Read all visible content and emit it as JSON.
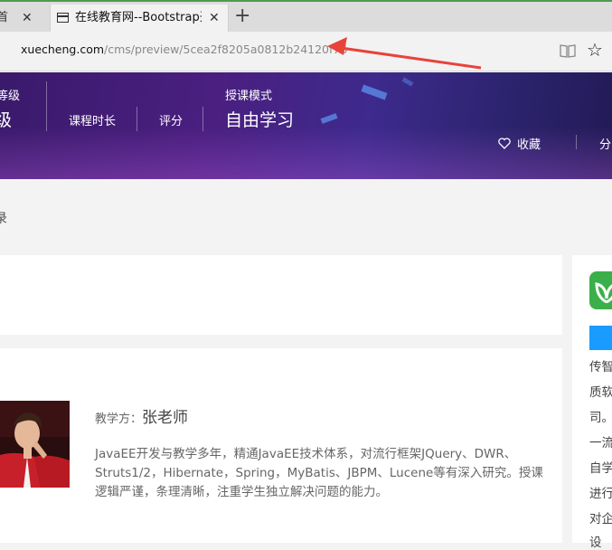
{
  "browser": {
    "inactive_tab": {
      "title": "首",
      "close": "✕"
    },
    "active_tab": {
      "title": "在线教育网--Bootstrap开",
      "close": "✕"
    },
    "new_tab": "+",
    "url_host": "xuecheng.com",
    "url_path": "/cms/preview/5cea2f8205a0812b24120f76",
    "favorite": "☆"
  },
  "banner": {
    "level_label": "等级",
    "level_value": "级",
    "duration_label": "课程时长",
    "rating_label": "评分",
    "mode_label": "授课模式",
    "mode_value": "自由学习",
    "favorite_label": "收藏",
    "share_label": "分"
  },
  "breadcrumb": {
    "text": "录"
  },
  "teacher": {
    "label": "教学方：",
    "name": "张老师",
    "description": "JavaEE开发与教学多年，精通JavaEE技术体系，对流行框架JQuery、DWR、Struts1/2，Hibernate，Spring，MyBatis、JBPM、Lucene等有深入研究。授课逻辑严谨，条理清晰，注重学生独立解决问题的能力。"
  },
  "sidebar": {
    "lines": [
      "传智",
      "质软",
      "司。",
      "一流",
      "自学",
      "进行",
      "对企",
      "设"
    ]
  },
  "colors": {
    "banner": "#4a1f80",
    "sidebar_logo": "#3bb04a",
    "sidebar_button": "#1a9bff",
    "annotation_arrow": "#e8433a"
  }
}
